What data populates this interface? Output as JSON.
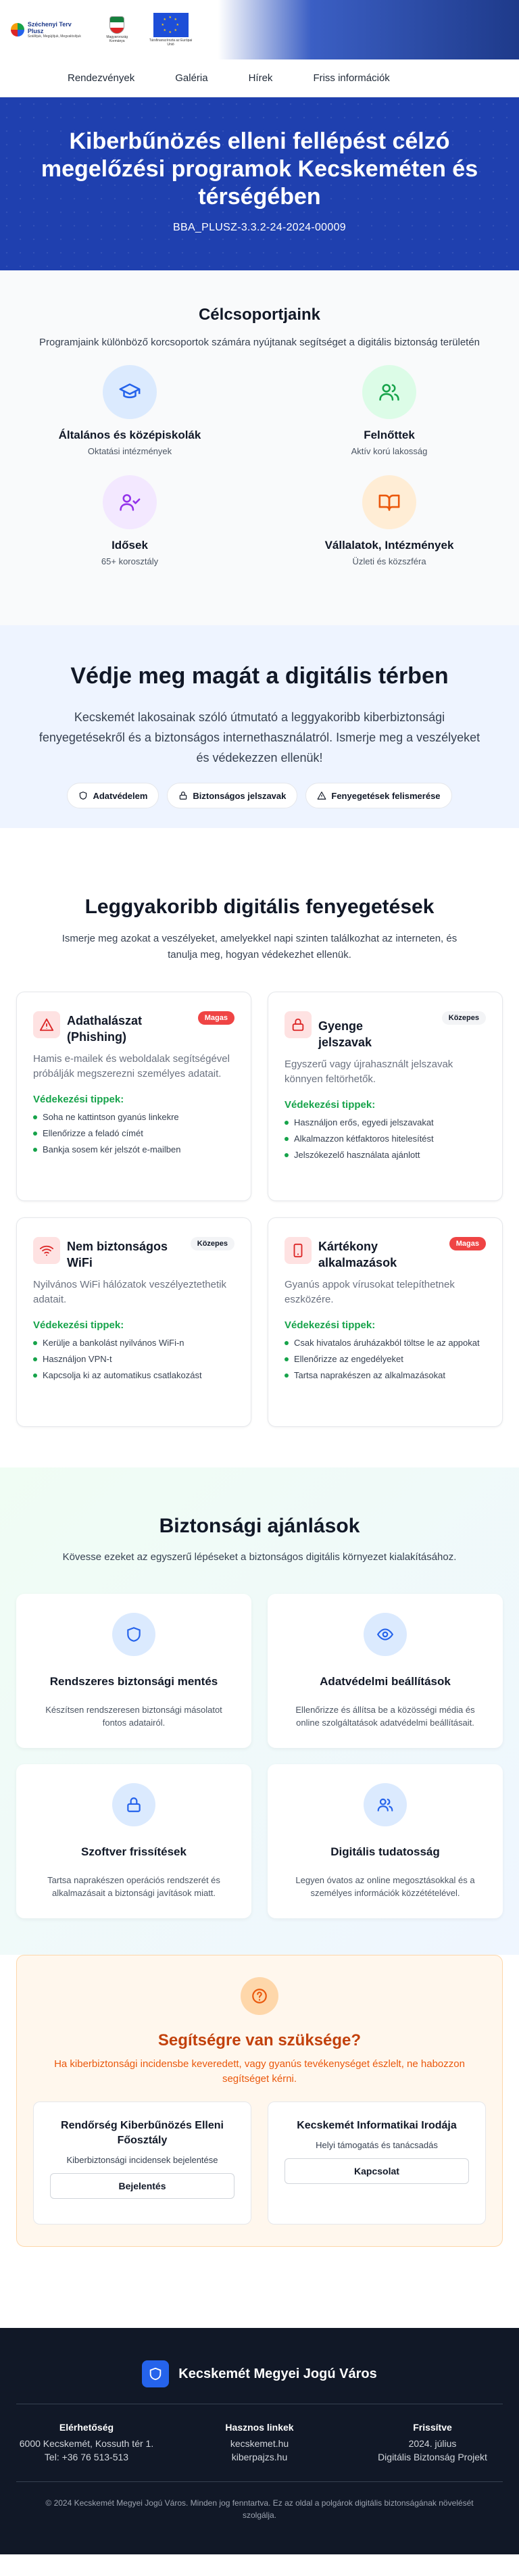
{
  "header": {
    "logo1_title": "Széchenyi Terv Plusz",
    "logo1_sub": "Szállítjuk, Megújítjuk, Megvalósítjuk",
    "logo2_sub": "Magyarország Kormánya",
    "logo3_sub": "Társfinanszírozta az Európai Unió"
  },
  "nav": {
    "items": [
      "Rendezvények",
      "Galéria",
      "Hírek",
      "Friss információk"
    ]
  },
  "hero": {
    "title": "Kiberbűnözés elleni fellépést célzó megelőzési programok Kecskeméten és térségében",
    "code": "BBA_PLUSZ-3.3.2-24-2024-00009"
  },
  "groups": {
    "title": "Célcsoportjaink",
    "subtitle": "Programjaink különböző korcsoportok számára nyújtanak segítséget a digitális biztonság területén",
    "items": [
      {
        "title": "Általános és középiskolák",
        "sub": "Oktatási intézmények",
        "icon": "graduation-cap-icon",
        "bg": "#dbeafe",
        "color": "#2563eb"
      },
      {
        "title": "Felnőttek",
        "sub": "Aktív korú lakosság",
        "icon": "users-icon",
        "bg": "#dcfce7",
        "color": "#16a34a"
      },
      {
        "title": "Idősek",
        "sub": "65+ korosztály",
        "icon": "user-check-icon",
        "bg": "#f3e8ff",
        "color": "#9333ea"
      },
      {
        "title": "Vállalatok, Intézmények",
        "sub": "Üzleti és közszféra",
        "icon": "book-open-icon",
        "bg": "#ffedd5",
        "color": "#ea580c"
      }
    ]
  },
  "protect": {
    "title": "Védje meg magát a digitális térben",
    "text": "Kecskemét lakosainak szóló útmutató a leggyakoribb kiberbiztonsági fenyegetésekről és a biztonságos internethasználatról. Ismerje meg a veszélyeket és védekezzen ellenük!",
    "pills": [
      "Adatvédelem",
      "Biztonságos jelszavak",
      "Fenyegetések felismerése"
    ]
  },
  "threats": {
    "title": "Leggyakoribb digitális fenyegetések",
    "subtitle": "Ismerje meg azokat a veszélyeket, amelyekkel napi szinten találkozhat az interneten, és tanulja meg, hogyan védekezhet ellenük.",
    "tips_label": "Védekezési tippek:",
    "items": [
      {
        "title": "Adathalászat (Phishing)",
        "badge": "Magas",
        "desc": "Hamis e-mailek és weboldalak segítségével próbálják megszerezni személyes adatait.",
        "tips": [
          "Soha ne kattintson gyanús linkekre",
          "Ellenőrizze a feladó címét",
          "Bankja sosem kér jelszót e-mailben"
        ]
      },
      {
        "title": "Gyenge jelszavak",
        "badge": "Közepes",
        "desc": "Egyszerű vagy újrahasznált jelszavak könnyen feltörhetők.",
        "tips": [
          "Használjon erős, egyedi jelszavakat",
          "Alkalmazzon kétfaktoros hitelesítést",
          "Jelszókezelő használata ajánlott"
        ]
      },
      {
        "title": "Nem biztonságos WiFi",
        "badge": "Közepes",
        "desc": "Nyilvános WiFi hálózatok veszélyeztethetik adatait.",
        "tips": [
          "Kerülje a bankolást nyilvános WiFi-n",
          "Használjon VPN-t",
          "Kapcsolja ki az automatikus csatlakozást"
        ]
      },
      {
        "title": "Kártékony alkalmazások",
        "badge": "Magas",
        "desc": "Gyanús appok vírusokat telepíthetnek eszközére.",
        "tips": [
          "Csak hivatalos áruházakból töltse le az appokat",
          "Ellenőrizze az engedélyeket",
          "Tartsa naprakészen az alkalmazásokat"
        ]
      }
    ]
  },
  "recs": {
    "title": "Biztonsági ajánlások",
    "subtitle": "Kövesse ezeket az egyszerű lépéseket a biztonságos digitális környezet kialakításához.",
    "items": [
      {
        "title": "Rendszeres biztonsági mentés",
        "desc": "Készítsen rendszeresen biztonsági másolatot fontos adatairól."
      },
      {
        "title": "Adatvédelmi beállítások",
        "desc": "Ellenőrizze és állítsa be a közösségi média és online szolgáltatások adatvédelmi beállításait."
      },
      {
        "title": "Szoftver frissítések",
        "desc": "Tartsa naprakészen operációs rendszerét és alkalmazásait a biztonsági javítások miatt."
      },
      {
        "title": "Digitális tudatosság",
        "desc": "Legyen óvatos az online megosztásokkal és a személyes információk közzétételével."
      }
    ]
  },
  "help": {
    "title": "Segítségre van szüksége?",
    "text": "Ha kiberbiztonsági incidensbe keveredett, vagy gyanús tevékenységet észlelt, ne habozzon segítséget kérni.",
    "cards": [
      {
        "name": "Rendőrség Kiberbűnözés Elleni Főosztály",
        "desc": "Kiberbiztonsági incidensek bejelentése",
        "button": "Bejelentés"
      },
      {
        "name": "Kecskemét Informatikai Irodája",
        "desc": "Helyi támogatás és tanácsadás",
        "button": "Kapcsolat"
      }
    ]
  },
  "footer": {
    "brand": "Kecskemét Megyei Jogú Város",
    "cols": [
      {
        "head": "Elérhetőség",
        "lines": [
          "6000 Kecskemét, Kossuth tér 1.",
          "Tel: +36 76 513-513"
        ]
      },
      {
        "head": "Hasznos linkek",
        "lines": [
          "kecskemet.hu",
          "kiberpajzs.hu"
        ]
      },
      {
        "head": "Frissítve",
        "lines": [
          "2024. július",
          "Digitális Biztonság Projekt"
        ]
      }
    ],
    "copyright": "© 2024 Kecskemét Megyei Jogú Város. Minden jog fenntartva. Ez az oldal a polgárok digitális biztonságának növelését szolgálja."
  }
}
